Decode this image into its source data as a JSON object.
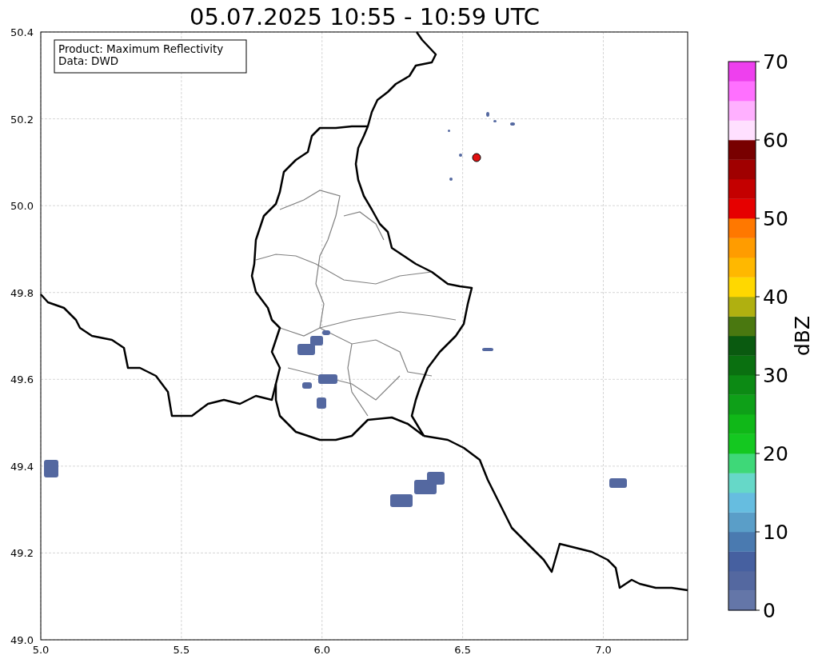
{
  "title": "05.07.2025 10:55 - 10:59 UTC",
  "info_box": [
    "Product: Maximum Reflectivity",
    "Data: DWD"
  ],
  "x_axis": {
    "ticks": [
      "5.0",
      "5.5",
      "6.0",
      "6.5",
      "7.0"
    ]
  },
  "y_axis": {
    "ticks": [
      "50.4",
      "50.2",
      "50.0",
      "49.8",
      "49.6",
      "49.4",
      "49.2",
      "49.0"
    ]
  },
  "colorbar": {
    "label": "dBZ",
    "ticks": [
      "70",
      "60",
      "50",
      "40",
      "30",
      "20",
      "10",
      "0"
    ],
    "segments": [
      {
        "color": "#6476a8"
      },
      {
        "color": "#5468a0"
      },
      {
        "color": "#4660a0"
      },
      {
        "color": "#4a7ab0"
      },
      {
        "color": "#5a9ec8"
      },
      {
        "color": "#66bde0"
      },
      {
        "color": "#66d8c8"
      },
      {
        "color": "#3ed878"
      },
      {
        "color": "#14c820"
      },
      {
        "color": "#10b818"
      },
      {
        "color": "#0ea018"
      },
      {
        "color": "#0c8a14"
      },
      {
        "color": "#0a7010"
      },
      {
        "color": "#0a5a10"
      },
      {
        "color": "#4a7810"
      },
      {
        "color": "#b0b010"
      },
      {
        "color": "#ffd800"
      },
      {
        "color": "#ffb800"
      },
      {
        "color": "#ff9c00"
      },
      {
        "color": "#ff7800"
      },
      {
        "color": "#e60000"
      },
      {
        "color": "#c40000"
      },
      {
        "color": "#a00000"
      },
      {
        "color": "#780000"
      },
      {
        "color": "#ffe0ff"
      },
      {
        "color": "#ffb0ff"
      },
      {
        "color": "#ff70ff"
      },
      {
        "color": "#ee40ee"
      }
    ]
  }
}
